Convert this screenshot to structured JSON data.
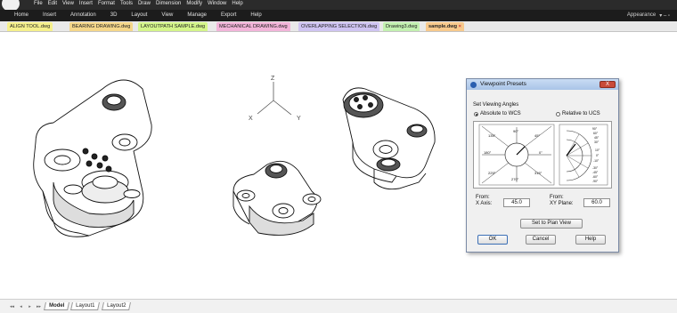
{
  "menubar": {
    "items": [
      "File",
      "Edit",
      "View",
      "Insert",
      "Format",
      "Tools",
      "Draw",
      "Dimension",
      "Modify",
      "Window",
      "Help"
    ]
  },
  "ribbon": {
    "tabs": [
      "Home",
      "Insert",
      "Annotation",
      "3D",
      "Layout",
      "View",
      "Manage",
      "Export",
      "Help"
    ],
    "appearance_label": "Appearance",
    "right_glyphs": "▾  –  ▫"
  },
  "doc_tabs": [
    {
      "label": "ALIGN TOOL.dwg",
      "color": "#f5f08c"
    },
    {
      "label": "BEARING DRAWING.dwg",
      "color": "#f5d78a"
    },
    {
      "label": "LAYOUTPATH SAMPLE.dwg",
      "color": "#d4f58a"
    },
    {
      "label": "MECHANICAL DRAWING.dwg",
      "color": "#f2b4d9"
    },
    {
      "label": "OVERLAPPING SELECTION.dwg",
      "color": "#cfc4f2"
    },
    {
      "label": "Drawing3.dwg",
      "color": "#c2f0b0"
    },
    {
      "label": "sample.dwg",
      "color": "#f7c98c"
    }
  ],
  "axes": {
    "z": "Z",
    "x": "X",
    "y": "Y"
  },
  "dialog": {
    "title": "Viewpoint Presets",
    "close_glyph": "X",
    "group_label": "Set Viewing Angles",
    "radio_absolute": "Absolute to WCS",
    "radio_relative": "Relative to UCS",
    "from_label_1": "From:",
    "x_axis_label": "X Axis:",
    "x_axis_value": "45.0",
    "from_label_2": "From:",
    "xy_plane_label": "XY Plane:",
    "xy_plane_value": "60.0",
    "plan_view_button": "Set to Plan View",
    "ok_button": "OK",
    "cancel_button": "Cancel",
    "help_button": "Help",
    "compass_labels": {
      "a90": "90°",
      "a45": "45°",
      "a0": "0°",
      "a315": "315°",
      "a270": "270°",
      "a225": "225°",
      "a180": "180°",
      "a135": "135°"
    },
    "elev_labels": {
      "e90": "90°",
      "e60": "60°",
      "e45": "45°",
      "e30": "30°",
      "e10": "10°",
      "e0": "0°",
      "n10": "-10°",
      "n30": "-30°",
      "n45": "-45°",
      "n60": "-60°",
      "n90": "-90°"
    }
  },
  "status": {
    "nav_glyphs": [
      "◂◂",
      "◂",
      "▸",
      "▸▸"
    ],
    "tab_model": "Model",
    "tab_layout1": "Layout1",
    "tab_layout2": "Layout2"
  }
}
